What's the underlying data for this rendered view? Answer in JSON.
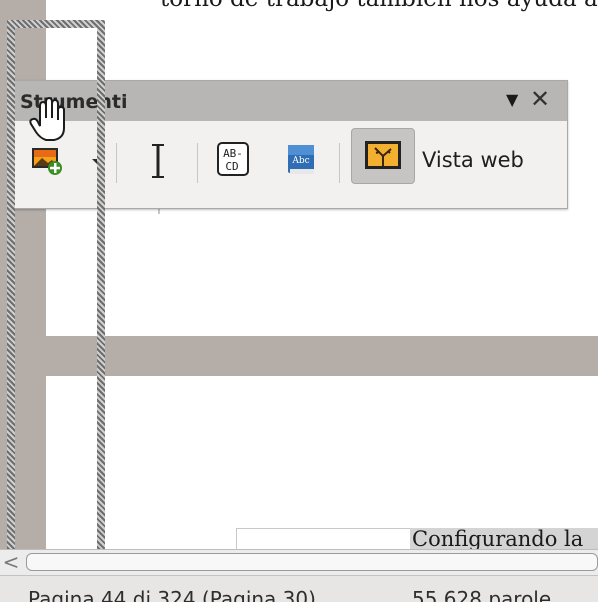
{
  "document": {
    "top_text": "torno de trabajo también nos ayuda a",
    "bottom_text": "Configurando la"
  },
  "toolbar": {
    "title": "Strumenti",
    "menu_glyph": "▼",
    "close_glyph": "✕",
    "web_view_label": "Vista web"
  },
  "scrollbar": {
    "left_arrow": "<"
  },
  "statusbar": {
    "page_info": "Pagina 44 di 324 (Pagina 30)",
    "word_count": "55.628 parole"
  },
  "colors": {
    "workspace": "#b4ada8",
    "toolbar_title_bg": "#b8b6b4",
    "toolbar_bg": "#f2f1f0",
    "web_button_active": "#c7c5c3"
  },
  "icons": [
    "insert-image-icon",
    "dropdown-arrow-icon",
    "text-cursor-icon",
    "autocorrect-icon",
    "spellcheck-icon",
    "web-view-icon",
    "hand-grab-cursor"
  ]
}
